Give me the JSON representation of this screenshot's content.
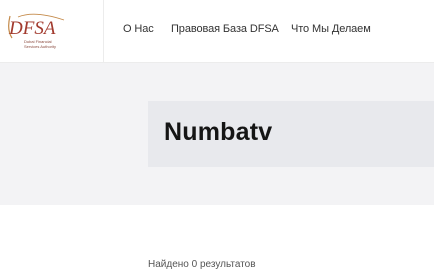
{
  "logo": {
    "mark": "DFSA",
    "tagline_lines": [
      "Dubai Financial",
      "Services Authority"
    ],
    "colors": {
      "primary": "#a23a2e",
      "accent": "#c48a4a"
    }
  },
  "nav": {
    "items": [
      {
        "label": "О Нас"
      },
      {
        "label": "Правовая База DFSA"
      },
      {
        "label": "Что Мы Делаем"
      }
    ]
  },
  "hero": {
    "title": "Numbatv"
  },
  "results": {
    "summary": "Найдено 0 результатов"
  },
  "theme": {
    "band_bg": "#f3f3f5",
    "card_bg": "#e8e9ed",
    "title_color": "#151515"
  }
}
